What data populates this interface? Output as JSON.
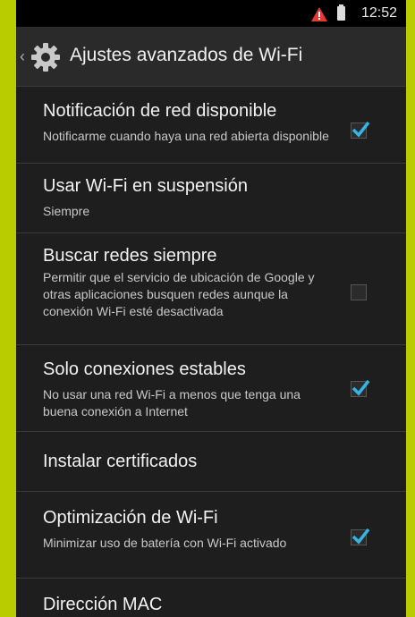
{
  "status_bar": {
    "time": "12:52",
    "icons": [
      "alert-icon",
      "battery-icon"
    ]
  },
  "action_bar": {
    "title": "Ajustes avanzados de Wi-Fi",
    "icon": "gear-icon",
    "up": "chevron-left-icon"
  },
  "settings": [
    {
      "title": "Notificación de red disponible",
      "summary": "Notificarme cuando haya una red abierta disponible",
      "checked": true
    },
    {
      "title": "Usar Wi-Fi en suspensión",
      "summary": "Siempre"
    },
    {
      "title": "Buscar redes siempre",
      "summary": "Permitir que el servicio de ubicación de Google y otras aplicaciones busquen redes aunque la conexión Wi-Fi esté desactivada",
      "checked": false
    },
    {
      "title": "Solo conexiones estables",
      "summary": "No usar una red Wi-Fi a menos que tenga una buena conexión a Internet",
      "checked": true
    },
    {
      "title": "Instalar certificados"
    },
    {
      "title": "Optimización de Wi-Fi",
      "summary": "Minimizar uso de batería con Wi-Fi activado",
      "checked": true
    },
    {
      "title": "Dirección MAC"
    }
  ],
  "colors": {
    "background_frame": "#b8cc00",
    "screen": "#1e1e1e",
    "accent": "#33b5e5",
    "text_primary": "#f2f2f2",
    "text_secondary": "#c8c8c8"
  }
}
